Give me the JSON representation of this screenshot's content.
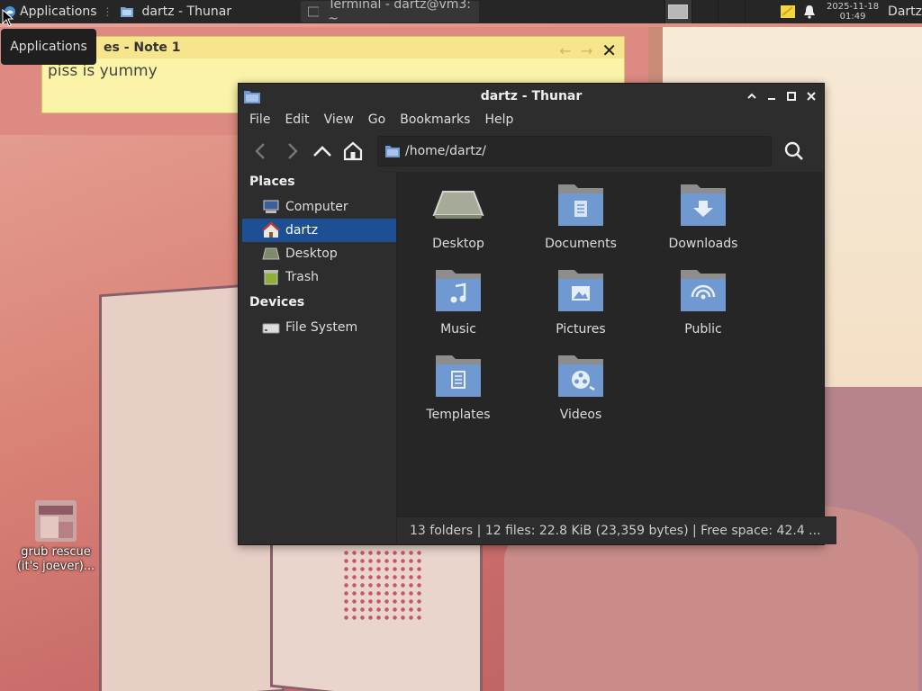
{
  "taskbar": {
    "applications_label": "Applications",
    "tasks": [
      {
        "label": "dartz - Thunar",
        "active": true
      },
      {
        "label": "Terminal - dartz@vm3: ~",
        "active": false
      }
    ],
    "clock_date": "2025-11-18",
    "clock_time": "01:49",
    "user": "Dartz"
  },
  "tooltip": {
    "text": "Applications"
  },
  "note": {
    "title": "Notes - Note 1",
    "title_visible": "es - Note 1",
    "text": "piss  is yummy"
  },
  "window": {
    "title": "dartz - Thunar",
    "menu": [
      "File",
      "Edit",
      "View",
      "Go",
      "Bookmarks",
      "Help"
    ],
    "location": "/home/dartz/",
    "sidebar": {
      "places_heading": "Places",
      "places": [
        {
          "label": "Computer",
          "icon": "computer-icon",
          "selected": false
        },
        {
          "label": "dartz",
          "icon": "home-icon",
          "selected": true
        },
        {
          "label": "Desktop",
          "icon": "desktop-icon",
          "selected": false
        },
        {
          "label": "Trash",
          "icon": "trash-icon",
          "selected": false
        }
      ],
      "devices_heading": "Devices",
      "devices": [
        {
          "label": "File System",
          "icon": "drive-icon",
          "selected": false
        }
      ]
    },
    "files": [
      {
        "label": "Desktop",
        "icon": "desktop-folder-icon"
      },
      {
        "label": "Documents",
        "icon": "documents-folder-icon"
      },
      {
        "label": "Downloads",
        "icon": "downloads-folder-icon"
      },
      {
        "label": "Music",
        "icon": "music-folder-icon"
      },
      {
        "label": "Pictures",
        "icon": "pictures-folder-icon"
      },
      {
        "label": "Public",
        "icon": "public-folder-icon"
      },
      {
        "label": "Templates",
        "icon": "templates-folder-icon"
      },
      {
        "label": "Videos",
        "icon": "videos-folder-icon"
      }
    ],
    "status": "13 folders  |  12 files: 22.8 KiB (23,359 bytes)  |  Free space: 42.4 ..."
  },
  "desktop_icon": {
    "label": "grub rescue (it's joever)..."
  },
  "colors": {
    "selection": "#1c4f94",
    "folder": "#6f99d0",
    "taskbar": "#262626",
    "note": "#fbf4a8"
  }
}
